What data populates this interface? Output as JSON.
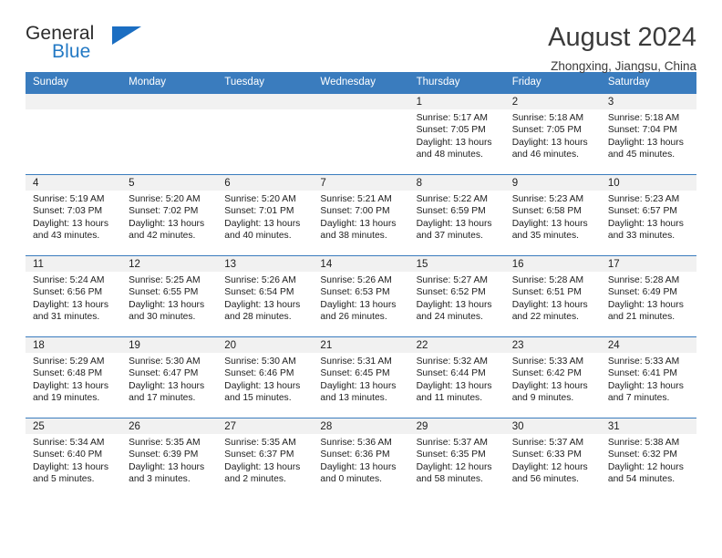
{
  "logo": {
    "word_one": "General",
    "word_two": "Blue",
    "triangle_color": "#1b6ec2",
    "blue_color": "#2379c4"
  },
  "header": {
    "title": "August 2024",
    "location": "Zhongxing, Jiangsu, China"
  },
  "theme": {
    "header_blue": "#3a7cbe",
    "daynum_bg": "#f1f1f1"
  },
  "weekdays": [
    "Sunday",
    "Monday",
    "Tuesday",
    "Wednesday",
    "Thursday",
    "Friday",
    "Saturday"
  ],
  "weeks": [
    [
      {
        "day": "",
        "sunrise": "",
        "sunset": "",
        "daylight_1": "",
        "daylight_2": ""
      },
      {
        "day": "",
        "sunrise": "",
        "sunset": "",
        "daylight_1": "",
        "daylight_2": ""
      },
      {
        "day": "",
        "sunrise": "",
        "sunset": "",
        "daylight_1": "",
        "daylight_2": ""
      },
      {
        "day": "",
        "sunrise": "",
        "sunset": "",
        "daylight_1": "",
        "daylight_2": ""
      },
      {
        "day": "1",
        "sunrise": "Sunrise: 5:17 AM",
        "sunset": "Sunset: 7:05 PM",
        "daylight_1": "Daylight: 13 hours",
        "daylight_2": "and 48 minutes."
      },
      {
        "day": "2",
        "sunrise": "Sunrise: 5:18 AM",
        "sunset": "Sunset: 7:05 PM",
        "daylight_1": "Daylight: 13 hours",
        "daylight_2": "and 46 minutes."
      },
      {
        "day": "3",
        "sunrise": "Sunrise: 5:18 AM",
        "sunset": "Sunset: 7:04 PM",
        "daylight_1": "Daylight: 13 hours",
        "daylight_2": "and 45 minutes."
      }
    ],
    [
      {
        "day": "4",
        "sunrise": "Sunrise: 5:19 AM",
        "sunset": "Sunset: 7:03 PM",
        "daylight_1": "Daylight: 13 hours",
        "daylight_2": "and 43 minutes."
      },
      {
        "day": "5",
        "sunrise": "Sunrise: 5:20 AM",
        "sunset": "Sunset: 7:02 PM",
        "daylight_1": "Daylight: 13 hours",
        "daylight_2": "and 42 minutes."
      },
      {
        "day": "6",
        "sunrise": "Sunrise: 5:20 AM",
        "sunset": "Sunset: 7:01 PM",
        "daylight_1": "Daylight: 13 hours",
        "daylight_2": "and 40 minutes."
      },
      {
        "day": "7",
        "sunrise": "Sunrise: 5:21 AM",
        "sunset": "Sunset: 7:00 PM",
        "daylight_1": "Daylight: 13 hours",
        "daylight_2": "and 38 minutes."
      },
      {
        "day": "8",
        "sunrise": "Sunrise: 5:22 AM",
        "sunset": "Sunset: 6:59 PM",
        "daylight_1": "Daylight: 13 hours",
        "daylight_2": "and 37 minutes."
      },
      {
        "day": "9",
        "sunrise": "Sunrise: 5:23 AM",
        "sunset": "Sunset: 6:58 PM",
        "daylight_1": "Daylight: 13 hours",
        "daylight_2": "and 35 minutes."
      },
      {
        "day": "10",
        "sunrise": "Sunrise: 5:23 AM",
        "sunset": "Sunset: 6:57 PM",
        "daylight_1": "Daylight: 13 hours",
        "daylight_2": "and 33 minutes."
      }
    ],
    [
      {
        "day": "11",
        "sunrise": "Sunrise: 5:24 AM",
        "sunset": "Sunset: 6:56 PM",
        "daylight_1": "Daylight: 13 hours",
        "daylight_2": "and 31 minutes."
      },
      {
        "day": "12",
        "sunrise": "Sunrise: 5:25 AM",
        "sunset": "Sunset: 6:55 PM",
        "daylight_1": "Daylight: 13 hours",
        "daylight_2": "and 30 minutes."
      },
      {
        "day": "13",
        "sunrise": "Sunrise: 5:26 AM",
        "sunset": "Sunset: 6:54 PM",
        "daylight_1": "Daylight: 13 hours",
        "daylight_2": "and 28 minutes."
      },
      {
        "day": "14",
        "sunrise": "Sunrise: 5:26 AM",
        "sunset": "Sunset: 6:53 PM",
        "daylight_1": "Daylight: 13 hours",
        "daylight_2": "and 26 minutes."
      },
      {
        "day": "15",
        "sunrise": "Sunrise: 5:27 AM",
        "sunset": "Sunset: 6:52 PM",
        "daylight_1": "Daylight: 13 hours",
        "daylight_2": "and 24 minutes."
      },
      {
        "day": "16",
        "sunrise": "Sunrise: 5:28 AM",
        "sunset": "Sunset: 6:51 PM",
        "daylight_1": "Daylight: 13 hours",
        "daylight_2": "and 22 minutes."
      },
      {
        "day": "17",
        "sunrise": "Sunrise: 5:28 AM",
        "sunset": "Sunset: 6:49 PM",
        "daylight_1": "Daylight: 13 hours",
        "daylight_2": "and 21 minutes."
      }
    ],
    [
      {
        "day": "18",
        "sunrise": "Sunrise: 5:29 AM",
        "sunset": "Sunset: 6:48 PM",
        "daylight_1": "Daylight: 13 hours",
        "daylight_2": "and 19 minutes."
      },
      {
        "day": "19",
        "sunrise": "Sunrise: 5:30 AM",
        "sunset": "Sunset: 6:47 PM",
        "daylight_1": "Daylight: 13 hours",
        "daylight_2": "and 17 minutes."
      },
      {
        "day": "20",
        "sunrise": "Sunrise: 5:30 AM",
        "sunset": "Sunset: 6:46 PM",
        "daylight_1": "Daylight: 13 hours",
        "daylight_2": "and 15 minutes."
      },
      {
        "day": "21",
        "sunrise": "Sunrise: 5:31 AM",
        "sunset": "Sunset: 6:45 PM",
        "daylight_1": "Daylight: 13 hours",
        "daylight_2": "and 13 minutes."
      },
      {
        "day": "22",
        "sunrise": "Sunrise: 5:32 AM",
        "sunset": "Sunset: 6:44 PM",
        "daylight_1": "Daylight: 13 hours",
        "daylight_2": "and 11 minutes."
      },
      {
        "day": "23",
        "sunrise": "Sunrise: 5:33 AM",
        "sunset": "Sunset: 6:42 PM",
        "daylight_1": "Daylight: 13 hours",
        "daylight_2": "and 9 minutes."
      },
      {
        "day": "24",
        "sunrise": "Sunrise: 5:33 AM",
        "sunset": "Sunset: 6:41 PM",
        "daylight_1": "Daylight: 13 hours",
        "daylight_2": "and 7 minutes."
      }
    ],
    [
      {
        "day": "25",
        "sunrise": "Sunrise: 5:34 AM",
        "sunset": "Sunset: 6:40 PM",
        "daylight_1": "Daylight: 13 hours",
        "daylight_2": "and 5 minutes."
      },
      {
        "day": "26",
        "sunrise": "Sunrise: 5:35 AM",
        "sunset": "Sunset: 6:39 PM",
        "daylight_1": "Daylight: 13 hours",
        "daylight_2": "and 3 minutes."
      },
      {
        "day": "27",
        "sunrise": "Sunrise: 5:35 AM",
        "sunset": "Sunset: 6:37 PM",
        "daylight_1": "Daylight: 13 hours",
        "daylight_2": "and 2 minutes."
      },
      {
        "day": "28",
        "sunrise": "Sunrise: 5:36 AM",
        "sunset": "Sunset: 6:36 PM",
        "daylight_1": "Daylight: 13 hours",
        "daylight_2": "and 0 minutes."
      },
      {
        "day": "29",
        "sunrise": "Sunrise: 5:37 AM",
        "sunset": "Sunset: 6:35 PM",
        "daylight_1": "Daylight: 12 hours",
        "daylight_2": "and 58 minutes."
      },
      {
        "day": "30",
        "sunrise": "Sunrise: 5:37 AM",
        "sunset": "Sunset: 6:33 PM",
        "daylight_1": "Daylight: 12 hours",
        "daylight_2": "and 56 minutes."
      },
      {
        "day": "31",
        "sunrise": "Sunrise: 5:38 AM",
        "sunset": "Sunset: 6:32 PM",
        "daylight_1": "Daylight: 12 hours",
        "daylight_2": "and 54 minutes."
      }
    ]
  ]
}
